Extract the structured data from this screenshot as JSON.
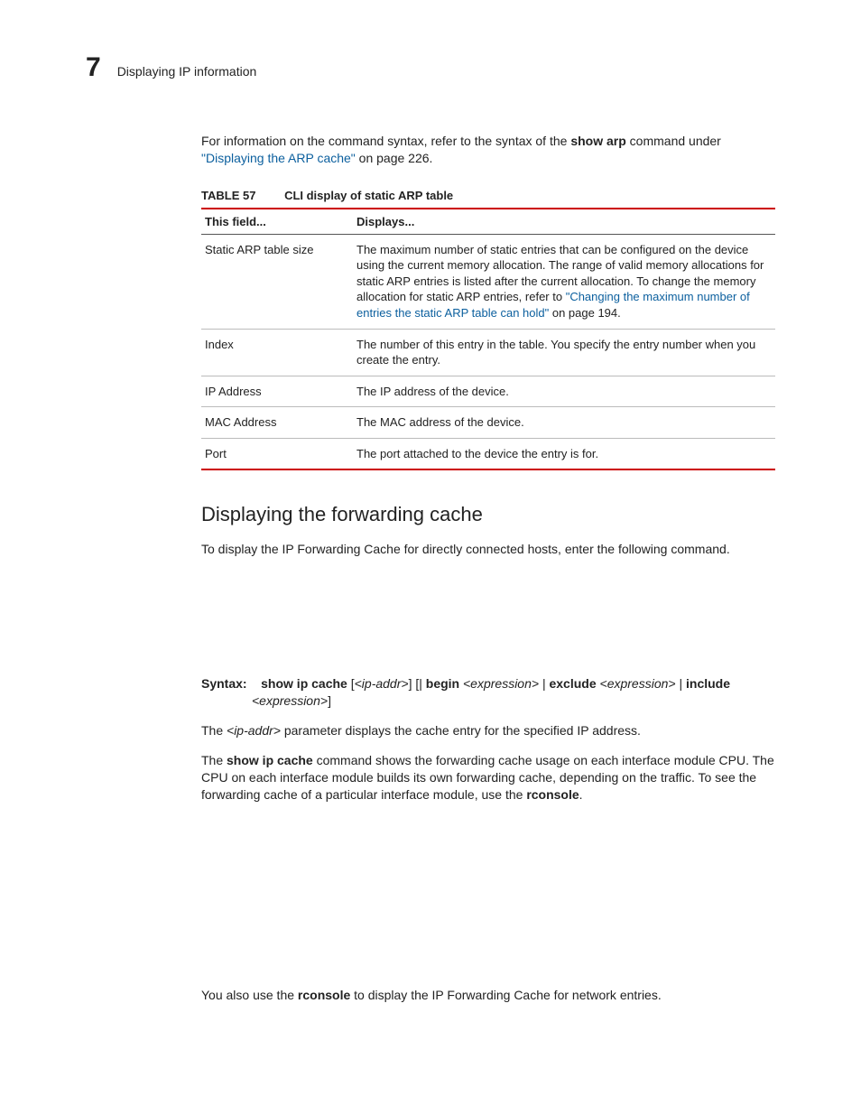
{
  "header": {
    "chapter_number": "7",
    "section_title": "Displaying IP information"
  },
  "intro": {
    "pre": "For information on the command syntax, refer to the syntax of the ",
    "cmd": "show arp",
    "post": " command under ",
    "link_text": "\"Displaying the ARP cache\"",
    "after_link": " on page 226."
  },
  "table": {
    "label": "TABLE 57",
    "title": "CLI display of static ARP table",
    "headers": {
      "field": "This field...",
      "displays": "Displays..."
    },
    "rows": {
      "r0": {
        "field": "Static ARP table size",
        "desc_pre": "The maximum number of static entries that can be configured on the device using the current memory allocation. The range of valid memory allocations for static ARP entries is listed after the current allocation. To change the memory allocation for static ARP entries, refer to ",
        "link": "\"Changing the maximum number of entries the static ARP table can hold\"",
        "desc_post": " on page 194."
      },
      "r1": {
        "field": "Index",
        "desc": "The number of this entry in the table.  You specify the entry number when you create the entry."
      },
      "r2": {
        "field": "IP Address",
        "desc": "The IP address of the device."
      },
      "r3": {
        "field": "MAC Address",
        "desc": "The MAC address of the device."
      },
      "r4": {
        "field": "Port",
        "desc": "The port attached to the device the entry is for."
      }
    }
  },
  "subheading": "Displaying the forwarding cache",
  "fwd_intro": "To display the IP Forwarding Cache for directly connected hosts, enter the following command.",
  "syntax": {
    "label": "Syntax:",
    "cmd": "show ip cache",
    "seg1_open": " [",
    "arg1": "<ip-addr>",
    "seg1_close": "] [| ",
    "kw_begin": "begin",
    "sp1": " ",
    "arg2": "<expression>",
    "pipe2": " | ",
    "kw_exclude": "exclude",
    "sp2": " ",
    "arg3": "<expression>",
    "pipe3": " | ",
    "kw_include": "include",
    "line2_arg": "<expression>",
    "line2_close": "]"
  },
  "para_ipaddr": {
    "pre": "The ",
    "arg": "<ip-addr>",
    "post": " parameter displays the cache entry for the specified IP address."
  },
  "para_show_ip": {
    "pre": "The ",
    "cmd": "show ip cache",
    "mid": " command shows the forwarding cache usage on each interface module CPU. The CPU on each interface module builds its own forwarding cache, depending on the traffic. To see the forwarding cache of a particular interface module, use the ",
    "rconsole": "rconsole",
    "end": "."
  },
  "para_rconsole": {
    "pre": "You also use the ",
    "cmd": "rconsole",
    "post": " to display the IP Forwarding Cache for network entries."
  }
}
